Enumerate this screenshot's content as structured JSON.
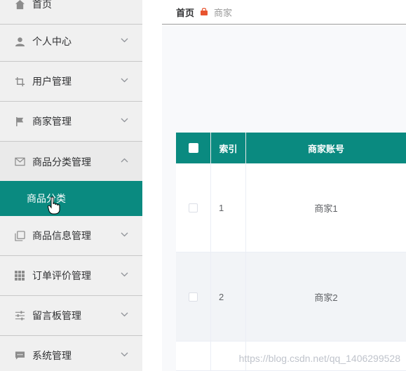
{
  "sidebar": {
    "home_label": "首页",
    "items": [
      {
        "label": "个人中心",
        "icon": "user-icon"
      },
      {
        "label": "用户管理",
        "icon": "crop-icon"
      },
      {
        "label": "商家管理",
        "icon": "flag-icon"
      },
      {
        "label": "商品分类管理",
        "icon": "mail-icon"
      },
      {
        "label": "商品信息管理",
        "icon": "copy-icon"
      },
      {
        "label": "订单评价管理",
        "icon": "grid-icon"
      },
      {
        "label": "留言板管理",
        "icon": "sliders-icon"
      },
      {
        "label": "系统管理",
        "icon": "chat-icon"
      }
    ],
    "sub_item": "商品分类"
  },
  "breadcrumb": {
    "home": "首页",
    "current": "商家"
  },
  "table": {
    "headers": {
      "index": "索引",
      "account": "商家账号"
    },
    "rows": [
      {
        "index": "1",
        "account": "商家1"
      },
      {
        "index": "2",
        "account": "商家2"
      }
    ]
  },
  "watermark": "https://blog.csdn.net/qq_1406299528",
  "colors": {
    "accent": "#0a8a80",
    "sidebar_bg": "#f0f0f0"
  }
}
